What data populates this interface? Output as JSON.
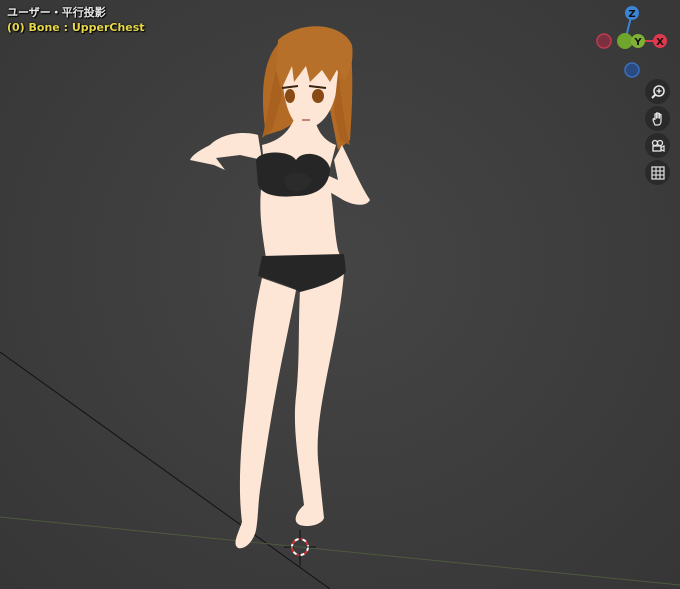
{
  "viewport": {
    "view_name": "ユーザー・平行投影",
    "active_object": "(0) Bone : UpperChest"
  },
  "gizmo": {
    "z_label": "Z",
    "y_label": "Y",
    "x_label": "X",
    "colors": {
      "x": "#e0384f",
      "y": "#7fb234",
      "z": "#3b84d6"
    }
  },
  "nav_buttons": {
    "zoom": "zoom-icon",
    "pan": "hand-icon",
    "camera": "camera-icon",
    "grid": "grid-icon"
  }
}
